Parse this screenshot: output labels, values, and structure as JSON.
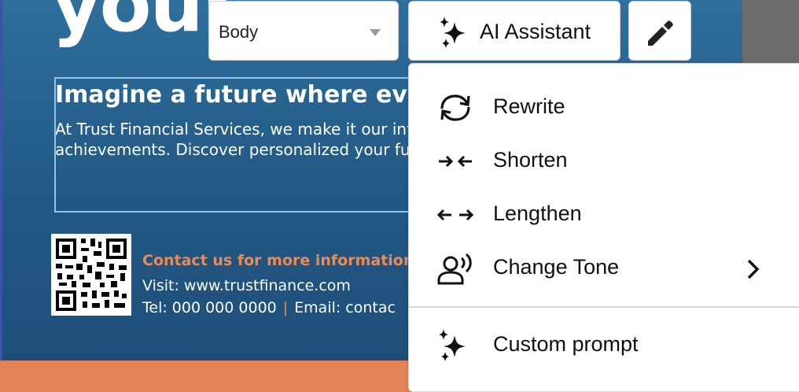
{
  "flyer": {
    "big_word": "your",
    "headline": "Imagine a future where eve",
    "body": "At Trust Financial Services, we make it our into achievements. Discover personalized your future today.",
    "contact_title": "Contact us for more information",
    "visit": "Visit: www.trustfinance.com",
    "tel": "Tel: 000 000 0000",
    "separator": "|",
    "email": "Email: contac"
  },
  "toolbar": {
    "style_value": "Body",
    "ai_label": "AI Assistant",
    "icons": {
      "ai": "sparkles-icon",
      "edit": "pencil-icon",
      "dropdown": "chevron-down-icon"
    }
  },
  "menu": {
    "items": [
      {
        "label": "Rewrite",
        "icon": "rewrite-icon"
      },
      {
        "label": "Shorten",
        "icon": "shorten-icon"
      },
      {
        "label": "Lengthen",
        "icon": "lengthen-icon"
      },
      {
        "label": "Change Tone",
        "icon": "tone-icon",
        "has_submenu": true
      },
      {
        "label": "Custom prompt",
        "icon": "sparkles-icon"
      }
    ]
  },
  "colors": {
    "flyer_blue": "#235a86",
    "accent_orange": "#e2835a",
    "selection_border": "#8fc4ec",
    "side_gray": "#6b6b6b"
  }
}
